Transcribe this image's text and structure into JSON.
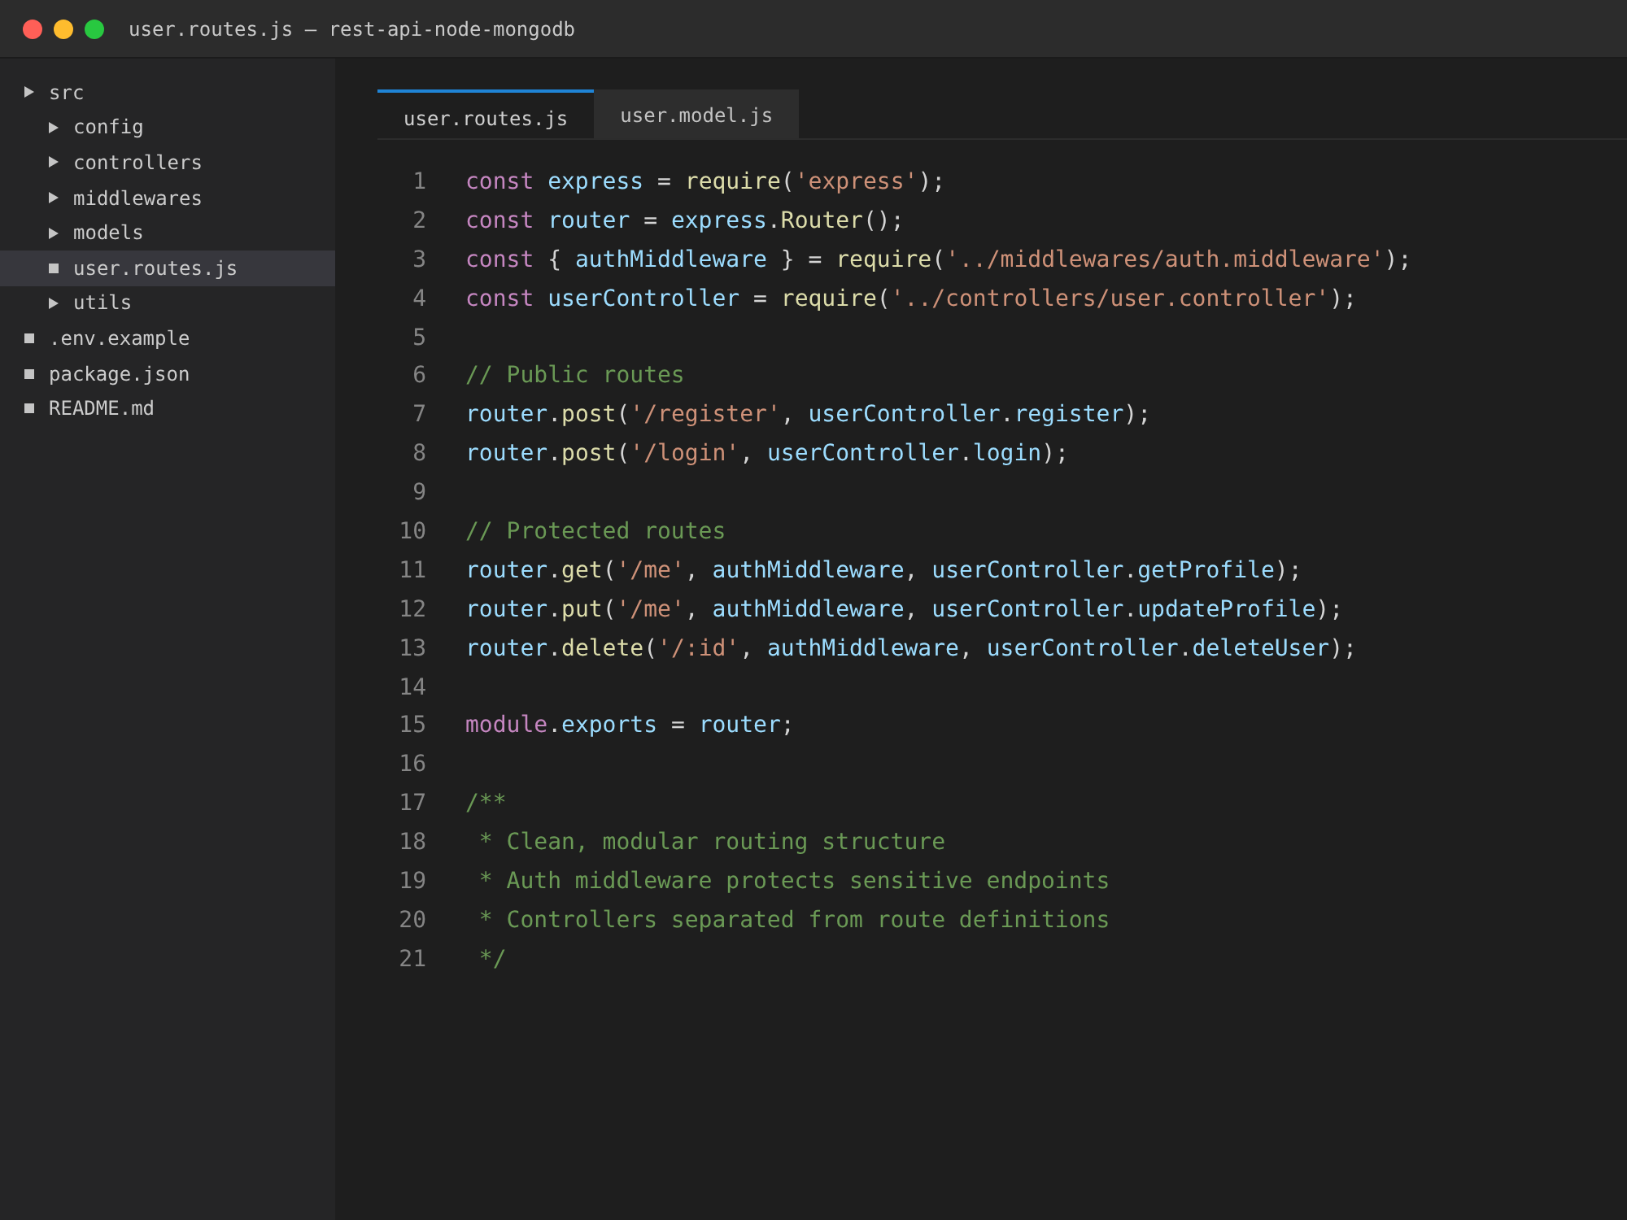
{
  "window": {
    "title": "user.routes.js — rest-api-node-mongodb",
    "controls": [
      {
        "color": "#ff5f57"
      },
      {
        "color": "#febc2e"
      },
      {
        "color": "#28c840"
      }
    ]
  },
  "sidebar": {
    "items": [
      {
        "kind": "folder",
        "name": "src",
        "selected": false,
        "children": [
          {
            "kind": "folder",
            "name": "config",
            "selected": false
          },
          {
            "kind": "folder",
            "name": "controllers",
            "selected": false
          },
          {
            "kind": "folder",
            "name": "middlewares",
            "selected": false
          },
          {
            "kind": "folder",
            "name": "models",
            "selected": false
          },
          {
            "kind": "file",
            "name": "user.routes.js",
            "selected": true
          },
          {
            "kind": "folder",
            "name": "utils",
            "selected": false
          }
        ]
      },
      {
        "kind": "file",
        "name": ".env.example",
        "selected": false
      },
      {
        "kind": "file",
        "name": "package.json",
        "selected": false
      },
      {
        "kind": "file",
        "name": "README.md",
        "selected": false
      }
    ]
  },
  "tabs": [
    {
      "label": "user.routes.js",
      "selected": true
    },
    {
      "label": "user.model.js",
      "selected": false
    }
  ],
  "editor": {
    "lines": [
      {
        "number": "1",
        "tokens": [
          {
            "kind": "keyword",
            "text": "const "
          },
          {
            "kind": "variable",
            "text": "express"
          },
          {
            "kind": "plain",
            "text": " = "
          },
          {
            "kind": "function",
            "text": "require"
          },
          {
            "kind": "plain",
            "text": "("
          },
          {
            "kind": "string",
            "text": "'express'"
          },
          {
            "kind": "plain",
            "text": ");"
          }
        ]
      },
      {
        "number": "2",
        "tokens": [
          {
            "kind": "keyword",
            "text": "const "
          },
          {
            "kind": "variable",
            "text": "router"
          },
          {
            "kind": "plain",
            "text": " = "
          },
          {
            "kind": "variable",
            "text": "express"
          },
          {
            "kind": "plain",
            "text": "."
          },
          {
            "kind": "function",
            "text": "Router"
          },
          {
            "kind": "plain",
            "text": "();"
          }
        ]
      },
      {
        "number": "3",
        "tokens": [
          {
            "kind": "keyword",
            "text": "const "
          },
          {
            "kind": "plain",
            "text": "{ "
          },
          {
            "kind": "variable",
            "text": "authMiddleware"
          },
          {
            "kind": "plain",
            "text": " } = "
          },
          {
            "kind": "function",
            "text": "require"
          },
          {
            "kind": "plain",
            "text": "("
          },
          {
            "kind": "string",
            "text": "'../middlewares/auth.middleware'"
          },
          {
            "kind": "plain",
            "text": ");"
          }
        ]
      },
      {
        "number": "4",
        "tokens": [
          {
            "kind": "keyword",
            "text": "const "
          },
          {
            "kind": "variable",
            "text": "userController"
          },
          {
            "kind": "plain",
            "text": " = "
          },
          {
            "kind": "function",
            "text": "require"
          },
          {
            "kind": "plain",
            "text": "("
          },
          {
            "kind": "string",
            "text": "'../controllers/user.controller'"
          },
          {
            "kind": "plain",
            "text": ");"
          }
        ]
      },
      {
        "number": "5"
      },
      {
        "number": "6",
        "tokens": [
          {
            "kind": "comment",
            "text": "// Public routes"
          }
        ]
      },
      {
        "number": "7",
        "tokens": [
          {
            "kind": "variable",
            "text": "router"
          },
          {
            "kind": "plain",
            "text": "."
          },
          {
            "kind": "function",
            "text": "post"
          },
          {
            "kind": "plain",
            "text": "("
          },
          {
            "kind": "string",
            "text": "'/register'"
          },
          {
            "kind": "plain",
            "text": ", "
          },
          {
            "kind": "variable",
            "text": "userController"
          },
          {
            "kind": "plain",
            "text": "."
          },
          {
            "kind": "variable",
            "text": "register"
          },
          {
            "kind": "plain",
            "text": ");"
          }
        ]
      },
      {
        "number": "8",
        "tokens": [
          {
            "kind": "variable",
            "text": "router"
          },
          {
            "kind": "plain",
            "text": "."
          },
          {
            "kind": "function",
            "text": "post"
          },
          {
            "kind": "plain",
            "text": "("
          },
          {
            "kind": "string",
            "text": "'/login'"
          },
          {
            "kind": "plain",
            "text": ", "
          },
          {
            "kind": "variable",
            "text": "userController"
          },
          {
            "kind": "plain",
            "text": "."
          },
          {
            "kind": "variable",
            "text": "login"
          },
          {
            "kind": "plain",
            "text": ");"
          }
        ]
      },
      {
        "number": "9"
      },
      {
        "number": "10",
        "tokens": [
          {
            "kind": "comment",
            "text": "// Protected routes"
          }
        ]
      },
      {
        "number": "11",
        "tokens": [
          {
            "kind": "variable",
            "text": "router"
          },
          {
            "kind": "plain",
            "text": "."
          },
          {
            "kind": "function",
            "text": "get"
          },
          {
            "kind": "plain",
            "text": "("
          },
          {
            "kind": "string",
            "text": "'/me'"
          },
          {
            "kind": "plain",
            "text": ", "
          },
          {
            "kind": "variable",
            "text": "authMiddleware"
          },
          {
            "kind": "plain",
            "text": ", "
          },
          {
            "kind": "variable",
            "text": "userController"
          },
          {
            "kind": "plain",
            "text": "."
          },
          {
            "kind": "variable",
            "text": "getProfile"
          },
          {
            "kind": "plain",
            "text": ");"
          }
        ]
      },
      {
        "number": "12",
        "tokens": [
          {
            "kind": "variable",
            "text": "router"
          },
          {
            "kind": "plain",
            "text": "."
          },
          {
            "kind": "function",
            "text": "put"
          },
          {
            "kind": "plain",
            "text": "("
          },
          {
            "kind": "string",
            "text": "'/me'"
          },
          {
            "kind": "plain",
            "text": ", "
          },
          {
            "kind": "variable",
            "text": "authMiddleware"
          },
          {
            "kind": "plain",
            "text": ", "
          },
          {
            "kind": "variable",
            "text": "userController"
          },
          {
            "kind": "plain",
            "text": "."
          },
          {
            "kind": "variable",
            "text": "updateProfile"
          },
          {
            "kind": "plain",
            "text": ");"
          }
        ]
      },
      {
        "number": "13",
        "tokens": [
          {
            "kind": "variable",
            "text": "router"
          },
          {
            "kind": "plain",
            "text": "."
          },
          {
            "kind": "function",
            "text": "delete"
          },
          {
            "kind": "plain",
            "text": "("
          },
          {
            "kind": "string",
            "text": "'/:id'"
          },
          {
            "kind": "plain",
            "text": ", "
          },
          {
            "kind": "variable",
            "text": "authMiddleware"
          },
          {
            "kind": "plain",
            "text": ", "
          },
          {
            "kind": "variable",
            "text": "userController"
          },
          {
            "kind": "plain",
            "text": "."
          },
          {
            "kind": "variable",
            "text": "deleteUser"
          },
          {
            "kind": "plain",
            "text": ");"
          }
        ]
      },
      {
        "number": "14"
      },
      {
        "number": "15",
        "tokens": [
          {
            "kind": "keyword",
            "text": "module"
          },
          {
            "kind": "plain",
            "text": "."
          },
          {
            "kind": "variable",
            "text": "exports"
          },
          {
            "kind": "plain",
            "text": " = "
          },
          {
            "kind": "variable",
            "text": "router"
          },
          {
            "kind": "plain",
            "text": ";"
          }
        ]
      },
      {
        "number": "16"
      },
      {
        "number": "17",
        "tokens": [
          {
            "kind": "comment",
            "text": "/**"
          }
        ]
      },
      {
        "number": "18",
        "tokens": [
          {
            "kind": "comment",
            "text": " * Clean, modular routing structure"
          }
        ]
      },
      {
        "number": "19",
        "tokens": [
          {
            "kind": "comment",
            "text": " * Auth middleware protects sensitive endpoints"
          }
        ]
      },
      {
        "number": "20",
        "tokens": [
          {
            "kind": "comment",
            "text": " * Controllers separated from route definitions"
          }
        ]
      },
      {
        "number": "21",
        "tokens": [
          {
            "kind": "comment",
            "text": " */"
          }
        ]
      }
    ]
  }
}
